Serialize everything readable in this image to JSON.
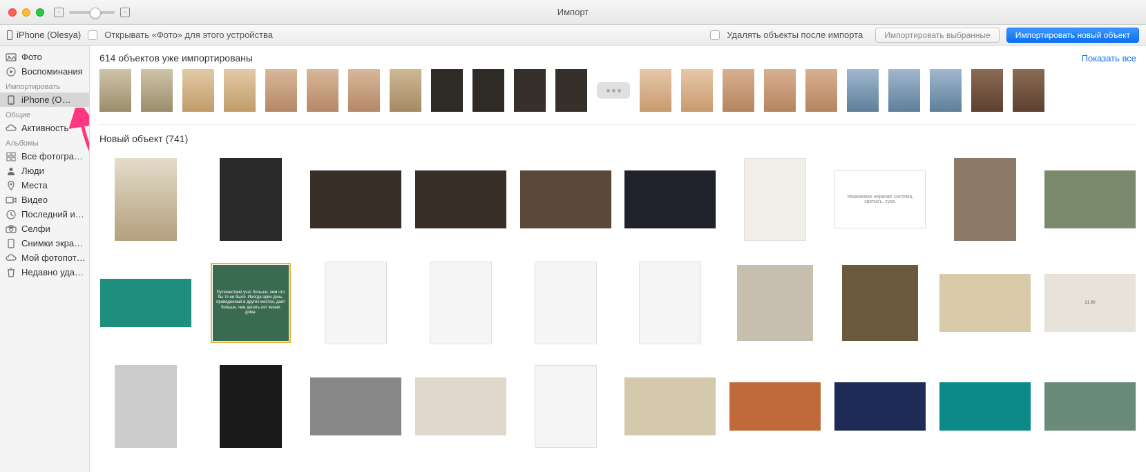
{
  "window_title": "Импорт",
  "device_name": "iPhone (Olesya)",
  "open_photos_label": "Открывать «Фото» для этого устройства",
  "delete_after_label": "Удалять объекты после импорта",
  "btn_import_selected": "Импортировать выбранные",
  "btn_import_new": "Импортировать новый объект",
  "sidebar": {
    "items": [
      {
        "label": "Фото",
        "icon": "photos"
      },
      {
        "label": "Воспоминания",
        "icon": "memories"
      }
    ],
    "import_header": "Импортировать",
    "import_item": "iPhone (O…",
    "shared_header": "Общие",
    "shared_item": "Активность",
    "albums_header": "Альбомы",
    "album_items": [
      {
        "label": "Все фотогра…",
        "icon": "all"
      },
      {
        "label": "Люди",
        "icon": "people"
      },
      {
        "label": "Места",
        "icon": "places"
      },
      {
        "label": "Видео",
        "icon": "video"
      },
      {
        "label": "Последний и…",
        "icon": "recent"
      },
      {
        "label": "Селфи",
        "icon": "selfie"
      },
      {
        "label": "Снимки экра…",
        "icon": "screenshot"
      },
      {
        "label": "Мой фотопот…",
        "icon": "stream"
      },
      {
        "label": "Недавно уда…",
        "icon": "trash"
      }
    ]
  },
  "already_imported_count": "614 объектов уже импортированы",
  "show_all": "Показать все",
  "new_objects_title": "Новый объект (741)",
  "quote_card": "Уважаемая нервная система, крепись, сука.",
  "travel_quote": "Путешествия учат больше, чем что бы то ни было. Иногда один день, проведенный в других местах, дает больше, чем десять лет жизни дома."
}
